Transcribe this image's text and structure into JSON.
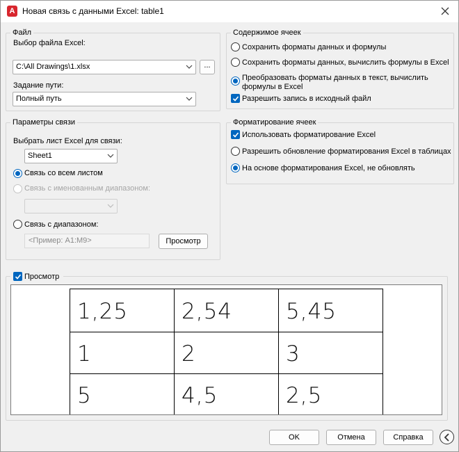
{
  "window": {
    "title": "Новая связь с данными Excel: table1",
    "app_icon": "A"
  },
  "file_group": {
    "legend": "Файл",
    "select_label": "Выбор файла Excel:",
    "file_value": "C:\\All Drawings\\1.xlsx",
    "browse_label": "...",
    "path_label": "Задание пути:",
    "path_value": "Полный путь"
  },
  "link_group": {
    "legend": "Параметры связи",
    "sheet_label": "Выбрать лист Excel для связи:",
    "sheet_value": "Sheet1",
    "options": [
      {
        "label": "Связь со всем листом",
        "selected": true,
        "enabled": true
      },
      {
        "label": "Связь с именованным диапазоном:",
        "selected": false,
        "enabled": false
      },
      {
        "label": "Связь с диапазоном:",
        "selected": false,
        "enabled": true
      }
    ],
    "range_placeholder": "<Пример: A1:M9>",
    "preview_button": "Просмотр"
  },
  "cell_contents": {
    "legend": "Содержимое ячеек",
    "options": [
      {
        "label": "Сохранить форматы данных и формулы",
        "selected": false
      },
      {
        "label": "Сохранить форматы данных, вычислить формулы в Excel",
        "selected": false
      },
      {
        "label_line1": "Преобразовать форматы данных в текст, вычислить",
        "label_line2": "формулы в Excel",
        "selected": true
      }
    ],
    "writeback_label": "Разрешить запись в исходный файл",
    "writeback_checked": true
  },
  "cell_formatting": {
    "legend": "Форматирование ячеек",
    "use_excel_label": "Использовать форматирование Excel",
    "use_excel_checked": true,
    "options": [
      {
        "label": "Разрешить обновление форматирования Excel в таблицах",
        "selected": false
      },
      {
        "label": "На основе форматирования Excel, не обновлять",
        "selected": true
      }
    ]
  },
  "preview": {
    "label": "Просмотр",
    "checked": true,
    "rows": [
      [
        "1,25",
        "2,54",
        "5,45"
      ],
      [
        "1",
        "2",
        "3"
      ],
      [
        "5",
        "4,5",
        "2,5"
      ]
    ]
  },
  "footer": {
    "ok": "OK",
    "cancel": "Отмена",
    "help": "Справка"
  },
  "colors": {
    "accent": "#0066bf",
    "app_icon": "#d8262e"
  }
}
